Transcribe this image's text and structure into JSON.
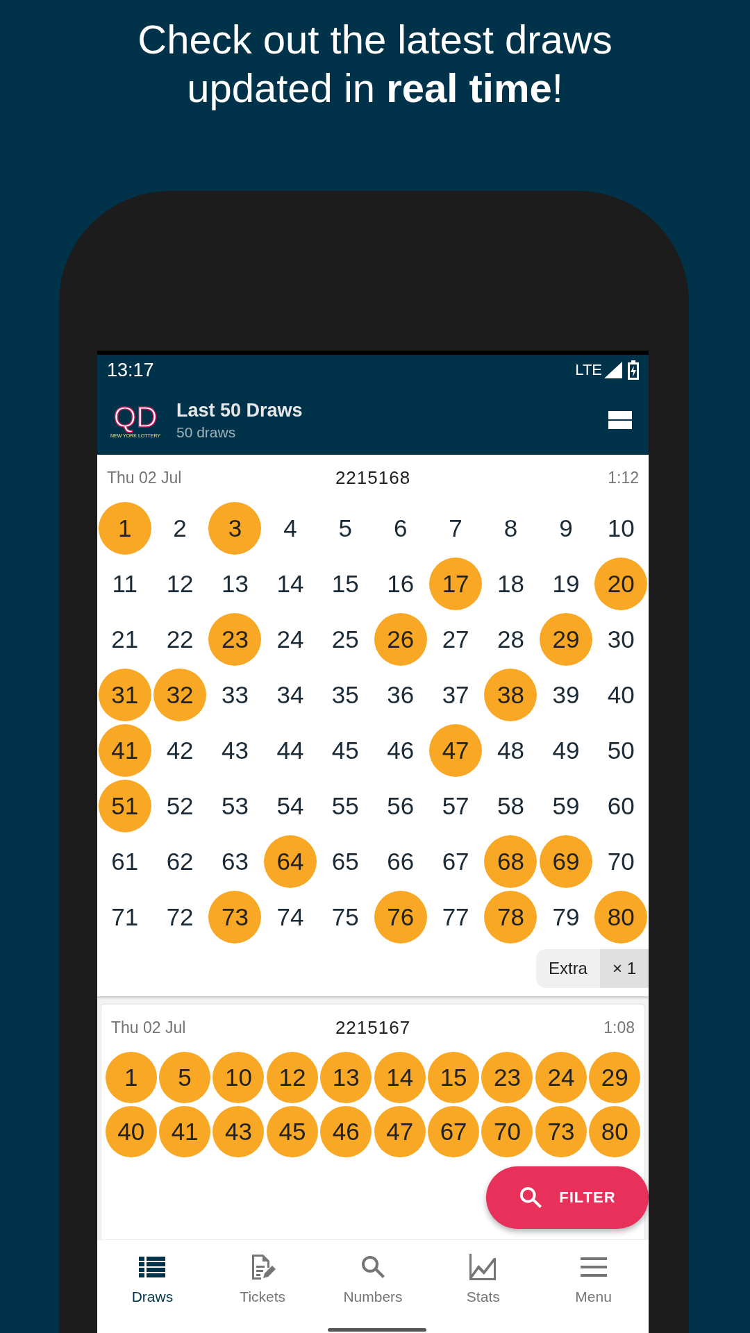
{
  "headline": "Check out the latest draws\nupdated in **real time**!",
  "status_bar": {
    "time": "13:17",
    "network": "LTE"
  },
  "app_bar": {
    "logo": {
      "letters": "QD",
      "caption": "NEW YORK LOTTERY"
    },
    "title": "Last 50 Draws",
    "subtitle": "50 draws"
  },
  "draws": [
    {
      "kind": "full_grid",
      "date": "Thu 02 Jul",
      "draw_number": "2215168",
      "time": "1:12",
      "extra": {
        "label": "Extra",
        "multiplier": "× 1"
      },
      "numbers": [
        {
          "value": "1",
          "drawn": true
        },
        {
          "value": "2",
          "drawn": false
        },
        {
          "value": "3",
          "drawn": true
        },
        {
          "value": "4",
          "drawn": false
        },
        {
          "value": "5",
          "drawn": false
        },
        {
          "value": "6",
          "drawn": false
        },
        {
          "value": "7",
          "drawn": false
        },
        {
          "value": "8",
          "drawn": false
        },
        {
          "value": "9",
          "drawn": false
        },
        {
          "value": "10",
          "drawn": false
        },
        {
          "value": "11",
          "drawn": false
        },
        {
          "value": "12",
          "drawn": false
        },
        {
          "value": "13",
          "drawn": false
        },
        {
          "value": "14",
          "drawn": false
        },
        {
          "value": "15",
          "drawn": false
        },
        {
          "value": "16",
          "drawn": false
        },
        {
          "value": "17",
          "drawn": true
        },
        {
          "value": "18",
          "drawn": false
        },
        {
          "value": "19",
          "drawn": false
        },
        {
          "value": "20",
          "drawn": true
        },
        {
          "value": "21",
          "drawn": false
        },
        {
          "value": "22",
          "drawn": false
        },
        {
          "value": "23",
          "drawn": true
        },
        {
          "value": "24",
          "drawn": false
        },
        {
          "value": "25",
          "drawn": false
        },
        {
          "value": "26",
          "drawn": true
        },
        {
          "value": "27",
          "drawn": false
        },
        {
          "value": "28",
          "drawn": false
        },
        {
          "value": "29",
          "drawn": true
        },
        {
          "value": "30",
          "drawn": false
        },
        {
          "value": "31",
          "drawn": true
        },
        {
          "value": "32",
          "drawn": true
        },
        {
          "value": "33",
          "drawn": false
        },
        {
          "value": "34",
          "drawn": false
        },
        {
          "value": "35",
          "drawn": false
        },
        {
          "value": "36",
          "drawn": false
        },
        {
          "value": "37",
          "drawn": false
        },
        {
          "value": "38",
          "drawn": true
        },
        {
          "value": "39",
          "drawn": false
        },
        {
          "value": "40",
          "drawn": false
        },
        {
          "value": "41",
          "drawn": true
        },
        {
          "value": "42",
          "drawn": false
        },
        {
          "value": "43",
          "drawn": false
        },
        {
          "value": "44",
          "drawn": false
        },
        {
          "value": "45",
          "drawn": false
        },
        {
          "value": "46",
          "drawn": false
        },
        {
          "value": "47",
          "drawn": true
        },
        {
          "value": "48",
          "drawn": false
        },
        {
          "value": "49",
          "drawn": false
        },
        {
          "value": "50",
          "drawn": false
        },
        {
          "value": "51",
          "drawn": true
        },
        {
          "value": "52",
          "drawn": false
        },
        {
          "value": "53",
          "drawn": false
        },
        {
          "value": "54",
          "drawn": false
        },
        {
          "value": "55",
          "drawn": false
        },
        {
          "value": "56",
          "drawn": false
        },
        {
          "value": "57",
          "drawn": false
        },
        {
          "value": "58",
          "drawn": false
        },
        {
          "value": "59",
          "drawn": false
        },
        {
          "value": "60",
          "drawn": false
        },
        {
          "value": "61",
          "drawn": false
        },
        {
          "value": "62",
          "drawn": false
        },
        {
          "value": "63",
          "drawn": false
        },
        {
          "value": "64",
          "drawn": true
        },
        {
          "value": "65",
          "drawn": false
        },
        {
          "value": "66",
          "drawn": false
        },
        {
          "value": "67",
          "drawn": false
        },
        {
          "value": "68",
          "drawn": true
        },
        {
          "value": "69",
          "drawn": true
        },
        {
          "value": "70",
          "drawn": false
        },
        {
          "value": "71",
          "drawn": false
        },
        {
          "value": "72",
          "drawn": false
        },
        {
          "value": "73",
          "drawn": true
        },
        {
          "value": "74",
          "drawn": false
        },
        {
          "value": "75",
          "drawn": false
        },
        {
          "value": "76",
          "drawn": true
        },
        {
          "value": "77",
          "drawn": false
        },
        {
          "value": "78",
          "drawn": true
        },
        {
          "value": "79",
          "drawn": false
        },
        {
          "value": "80",
          "drawn": true
        }
      ]
    },
    {
      "kind": "drawn_only",
      "date": "Thu 02 Jul",
      "draw_number": "2215167",
      "time": "1:08",
      "numbers": [
        {
          "value": "1",
          "drawn": true
        },
        {
          "value": "5",
          "drawn": true
        },
        {
          "value": "10",
          "drawn": true
        },
        {
          "value": "12",
          "drawn": true
        },
        {
          "value": "13",
          "drawn": true
        },
        {
          "value": "14",
          "drawn": true
        },
        {
          "value": "15",
          "drawn": true
        },
        {
          "value": "23",
          "drawn": true
        },
        {
          "value": "24",
          "drawn": true
        },
        {
          "value": "29",
          "drawn": true
        },
        {
          "value": "40",
          "drawn": true
        },
        {
          "value": "41",
          "drawn": true
        },
        {
          "value": "43",
          "drawn": true
        },
        {
          "value": "45",
          "drawn": true
        },
        {
          "value": "46",
          "drawn": true
        },
        {
          "value": "47",
          "drawn": true
        },
        {
          "value": "67",
          "drawn": true
        },
        {
          "value": "70",
          "drawn": true
        },
        {
          "value": "73",
          "drawn": true
        },
        {
          "value": "80",
          "drawn": true
        }
      ]
    }
  ],
  "fab": {
    "label": "FILTER"
  },
  "bottom_nav": [
    {
      "kind": "draws",
      "label": "Draws",
      "selected": true
    },
    {
      "kind": "tickets",
      "label": "Tickets",
      "selected": false
    },
    {
      "kind": "numbers",
      "label": "Numbers",
      "selected": false
    },
    {
      "kind": "stats",
      "label": "Stats",
      "selected": false
    },
    {
      "kind": "menu",
      "label": "Menu",
      "selected": false
    }
  ]
}
